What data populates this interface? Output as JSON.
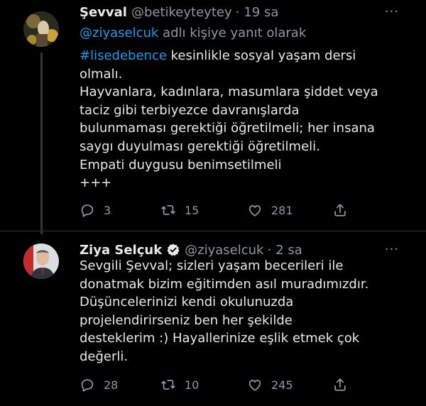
{
  "tweet1": {
    "name": "Şevval",
    "handle": "@betikeyteytey",
    "dot": "·",
    "time": "19 sa",
    "more": "···",
    "replying_mention": "@ziyaselcuk",
    "replying_text": " adlı kişiye yanıt olarak",
    "hashtag": "#lisedebence",
    "line1_rest": " kesinlikle sosyal yaşam dersi",
    "line2": "olmalı.",
    "line3": "Hayvanlara, kadınlara, masumlara şiddet veya",
    "line4": "taciz gibi terbiyezce davranışlarda",
    "line5": "bulunmaması gerektiği öğretilmeli; her insana",
    "line6": "saygı duyulması gerektiği öğretilmeli.",
    "line7": "Empati duygusu benimsetilmeli",
    "line8": "+++",
    "replies": "3",
    "retweets": "15",
    "likes": "281"
  },
  "tweet2": {
    "name": "Ziya Selçuk",
    "handle": "@ziyaselcuk",
    "dot": "·",
    "time": "2 sa",
    "more": "···",
    "line1": "Sevgili Şevval; sizleri yaşam becerileri ile",
    "line2": "donatmak bizim eğitimden asıl muradımızdır.",
    "line3": "Düşüncelerinizi kendi okulunuzda",
    "line4": "projelendirirseniz ben her şekilde",
    "line5": "desteklerim :) Hayallerinize eşlik etmek çok",
    "line6": "değerli.",
    "replies": "28",
    "retweets": "10",
    "likes": "245"
  },
  "colors": {
    "background": "#000000",
    "text": "#e7e9ea",
    "secondary": "#8b98a5",
    "link": "#1d9bf0",
    "divider": "#2f3336"
  },
  "icons": [
    "reply-icon",
    "retweet-icon",
    "like-icon",
    "share-icon",
    "verified-badge-icon",
    "more-icon"
  ]
}
